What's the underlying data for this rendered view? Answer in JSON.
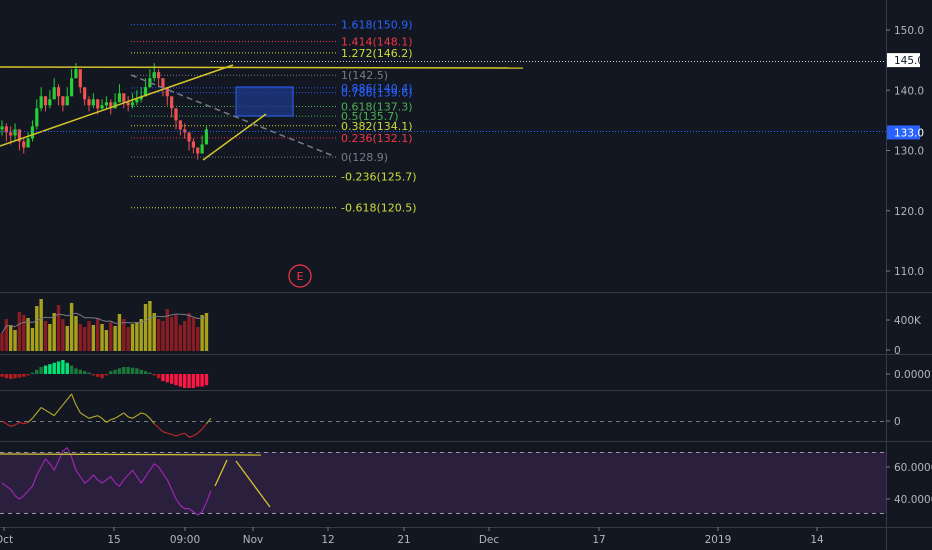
{
  "chart_data": {
    "type": "candlestick",
    "price_axis": {
      "ticks": [
        "150.0",
        "140.0",
        "130.0",
        "120.0",
        "110.0"
      ],
      "ylim": [
        103,
        153
      ]
    },
    "price_badges": [
      {
        "label": "145.0",
        "value": 145.0,
        "style": "white"
      },
      {
        "label": "133.0",
        "value": 133.0,
        "style": "blue"
      }
    ],
    "time_axis": {
      "ticks": [
        "Oct",
        "15",
        "09:00",
        "Nov",
        "12",
        "21",
        "Dec",
        "17",
        "2019",
        "14"
      ]
    },
    "candles": {
      "close": [
        134,
        133,
        132.5,
        133.5,
        131.5,
        130.5,
        132,
        134,
        137,
        139,
        137.5,
        138.5,
        140.5,
        139,
        137.5,
        139,
        142,
        143.5,
        140.5,
        138.5,
        137.5,
        138.5,
        137,
        137.5,
        138,
        137,
        138,
        139.5,
        138,
        137.5,
        138,
        138.5,
        139,
        140.5,
        142,
        143,
        142,
        140.5,
        139,
        137,
        135,
        133.5,
        133,
        131.5,
        130.5,
        129.5,
        131,
        133.5
      ],
      "high": [
        135,
        134.5,
        134,
        134.5,
        133.5,
        132,
        133,
        135,
        138.5,
        140.5,
        139,
        140,
        142,
        141,
        139,
        140.5,
        143.5,
        144.5,
        142,
        140,
        139,
        139.5,
        138.5,
        138.5,
        139,
        138.5,
        139.5,
        141,
        139.5,
        139,
        139.5,
        140,
        140.5,
        142,
        143.5,
        144.5,
        143.5,
        142,
        140.5,
        138.5,
        136.5,
        135,
        134.5,
        133,
        132,
        130.5,
        132.5,
        134
      ],
      "low": [
        132.5,
        131.5,
        131,
        131.5,
        130,
        129.5,
        130.5,
        131.5,
        133.5,
        136.5,
        136.5,
        137,
        138.5,
        137.5,
        136.5,
        137.5,
        139,
        142,
        139.5,
        137.5,
        136.5,
        137,
        136,
        136.5,
        137,
        136,
        137,
        138,
        137,
        136.5,
        137,
        137.5,
        138,
        139,
        140.5,
        141.5,
        140.5,
        139,
        137.5,
        135.5,
        133.5,
        132.5,
        132,
        130,
        129.5,
        128.5,
        129.5,
        131
      ]
    },
    "volume": {
      "axis_ticks": [
        "400K",
        "0"
      ],
      "values": [
        180,
        320,
        260,
        210,
        390,
        360,
        330,
        230,
        450,
        520,
        300,
        270,
        380,
        460,
        320,
        250,
        480,
        350,
        270,
        240,
        300,
        260,
        330,
        270,
        210,
        290,
        250,
        370,
        320,
        240,
        270,
        290,
        320,
        470,
        500,
        380,
        320,
        300,
        420,
        340,
        360,
        260,
        300,
        380,
        330,
        240,
        360,
        380
      ],
      "directions": [
        0,
        0,
        1,
        1,
        0,
        0,
        1,
        1,
        1,
        1,
        0,
        1,
        1,
        0,
        0,
        1,
        1,
        1,
        0,
        0,
        0,
        1,
        0,
        1,
        1,
        0,
        1,
        1,
        0,
        0,
        1,
        1,
        1,
        1,
        1,
        1,
        0,
        0,
        0,
        0,
        0,
        0,
        0,
        0,
        0,
        0,
        1,
        1
      ]
    },
    "histogram": {
      "axis_ticks": [
        "0.0000"
      ],
      "values": [
        -0.2,
        -0.3,
        -0.35,
        -0.3,
        -0.25,
        -0.2,
        -0.1,
        0.1,
        0.3,
        0.5,
        0.6,
        0.7,
        0.8,
        0.9,
        1.0,
        0.8,
        0.6,
        0.4,
        0.3,
        0.2,
        0.1,
        -0.1,
        -0.2,
        -0.3,
        -0.1,
        0.2,
        0.3,
        0.4,
        0.5,
        0.5,
        0.45,
        0.4,
        0.3,
        0.2,
        0.1,
        -0.1,
        -0.3,
        -0.5,
        -0.6,
        -0.7,
        -0.8,
        -0.9,
        -1.0,
        -1.0,
        -1.0,
        -0.9,
        -0.9,
        -0.8
      ]
    },
    "oscillator": {
      "axis_ticks": [
        "0"
      ],
      "values": [
        0,
        -10,
        -20,
        -15,
        -5,
        -10,
        -5,
        10,
        30,
        50,
        40,
        30,
        20,
        40,
        60,
        80,
        100,
        60,
        30,
        20,
        10,
        15,
        20,
        10,
        -5,
        5,
        10,
        20,
        30,
        15,
        10,
        20,
        30,
        25,
        10,
        -10,
        -25,
        -40,
        -45,
        -50,
        -55,
        -50,
        -45,
        -60,
        -55,
        -45,
        -30,
        -10,
        10
      ]
    },
    "rsi": {
      "axis_ticks": [
        "60.0000",
        "40.0000"
      ],
      "ylim": [
        29,
        77
      ],
      "values": [
        50,
        48,
        46,
        42,
        40,
        42,
        45,
        48,
        55,
        60,
        65,
        62,
        58,
        64,
        70,
        72,
        66,
        58,
        54,
        50,
        52,
        55,
        52,
        50,
        52,
        54,
        50,
        48,
        52,
        55,
        58,
        54,
        50,
        54,
        58,
        62,
        60,
        56,
        52,
        46,
        40,
        36,
        34,
        34,
        32,
        30,
        32,
        38,
        45
      ]
    },
    "fibonacci": [
      {
        "label": "1.618(150.9)",
        "value": 150.9,
        "color": "#2962ff"
      },
      {
        "label": "1.414(148.1)",
        "value": 148.1,
        "color": "#f23645"
      },
      {
        "label": "1.272(146.2)",
        "value": 146.2,
        "color": "#cddc39"
      },
      {
        "label": "1(142.5)",
        "value": 142.5,
        "color": "#787b86"
      },
      {
        "label": "0.886(140.4)",
        "value": 140.4,
        "color": "#2962ff"
      },
      {
        "label": "0.786(139.6)",
        "value": 139.6,
        "color": "#2962ff"
      },
      {
        "label": "0.618(137.3)",
        "value": 137.3,
        "color": "#4caf50"
      },
      {
        "label": "0.5(135.7)",
        "value": 135.7,
        "color": "#4caf50"
      },
      {
        "label": "0.382(134.1)",
        "value": 134.1,
        "color": "#cddc39"
      },
      {
        "label": "0.236(132.1)",
        "value": 132.1,
        "color": "#f23645"
      },
      {
        "label": "0(128.9)",
        "value": 128.9,
        "color": "#787b86"
      },
      {
        "label": "-0.236(125.7)",
        "value": 125.7,
        "color": "#cddc39"
      },
      {
        "label": "-0.618(120.5)",
        "value": 120.5,
        "color": "#cddc39"
      }
    ],
    "event_marker": "E",
    "colors": {
      "background": "#131722",
      "up": "#26a69a",
      "candle_up": "#26d032",
      "down": "#ef5350",
      "drawing": "#d4c629",
      "rsi_line": "#9c27b0",
      "rsi_band": "#2a1f3d",
      "badge_blue": "#2962ff"
    }
  }
}
